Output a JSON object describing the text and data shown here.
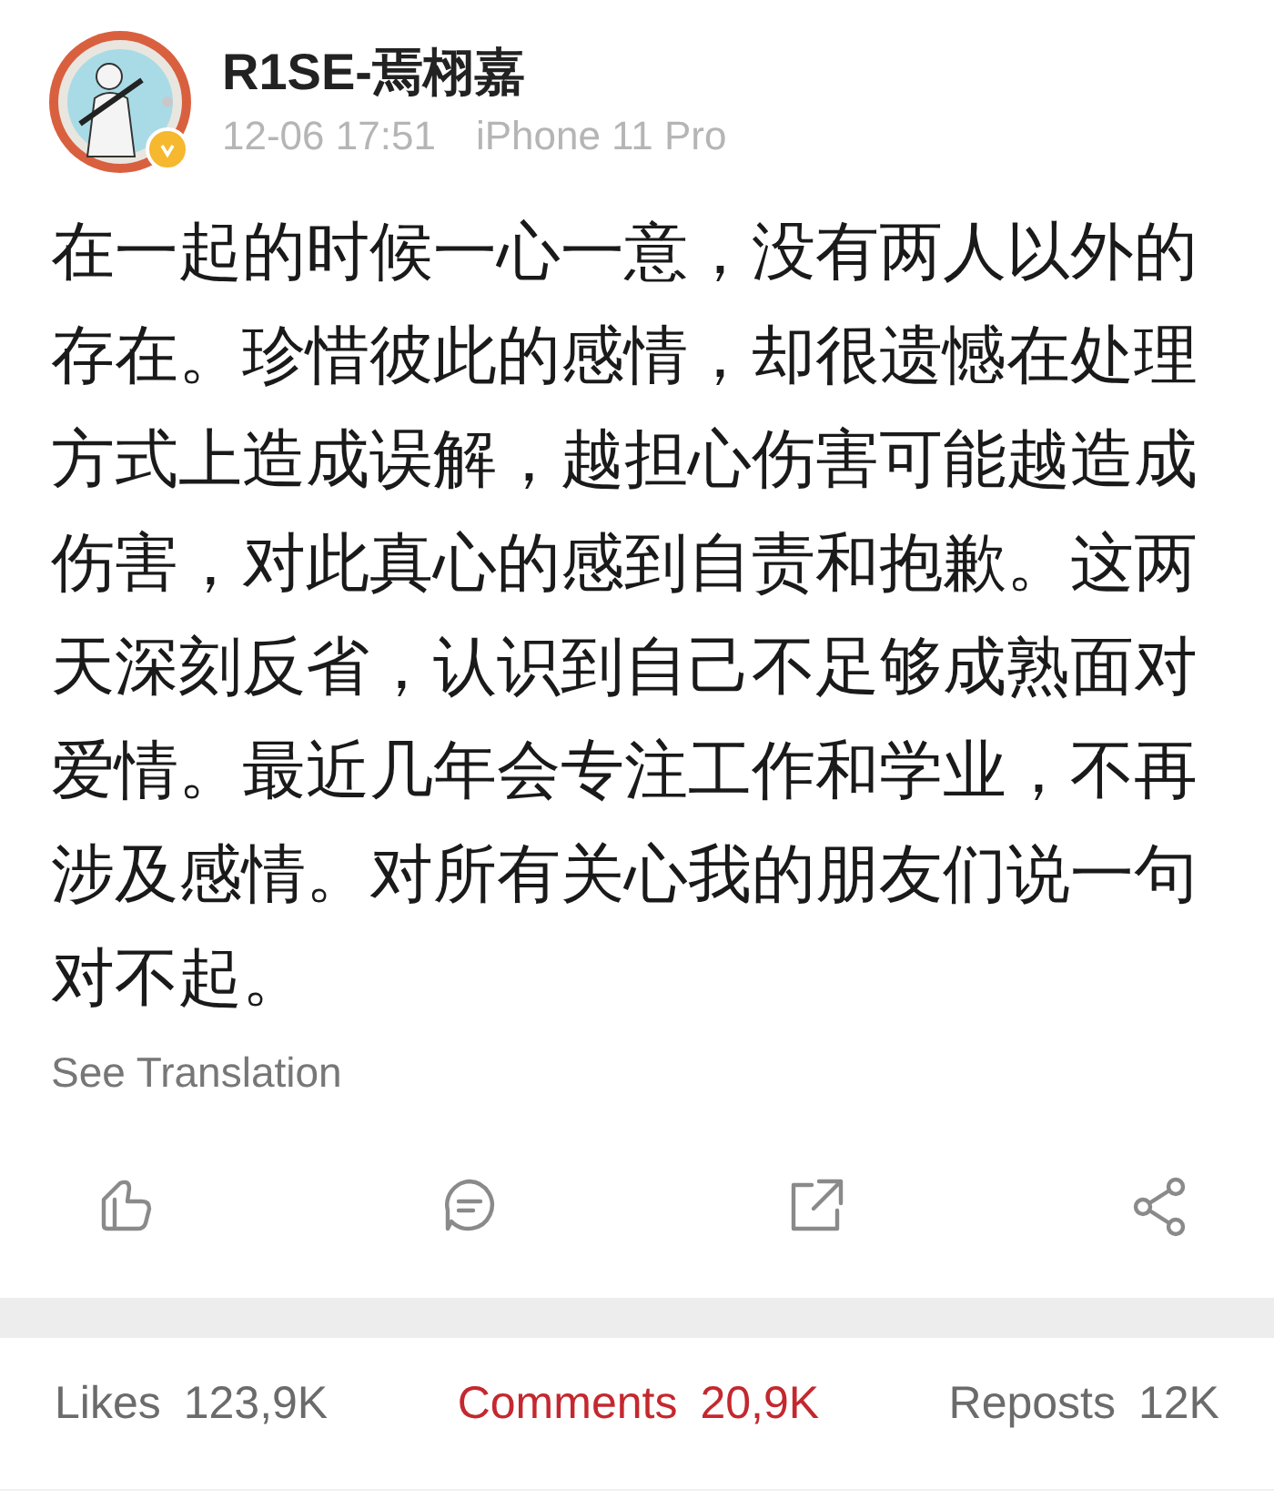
{
  "post": {
    "author": "R1SE-焉栩嘉",
    "verified": true,
    "time": "12-06 17:51",
    "device": "iPhone 11 Pro",
    "text": "在一起的时候一心一意，没有两人以外的存在。珍惜彼此的感情，却很遗憾在处理方式上造成误解，越担心伤害可能越造成伤害，对此真心的感到自责和抱歉。这两天深刻反省，认识到自己不足够成熟面对爱情。最近几年会专注工作和学业，不再涉及感情。对所有关心我的朋友们说一句对不起。",
    "translate_link": "See Translation"
  },
  "actions": [
    {
      "kind": "like"
    },
    {
      "kind": "comment"
    },
    {
      "kind": "repost"
    },
    {
      "kind": "share"
    }
  ],
  "tabs": [
    {
      "label": "Likes",
      "count": "123,9K",
      "selected": false
    },
    {
      "label": "Comments",
      "count": "20,9K",
      "selected": true
    },
    {
      "label": "Reposts",
      "count": "12K",
      "selected": false
    }
  ]
}
